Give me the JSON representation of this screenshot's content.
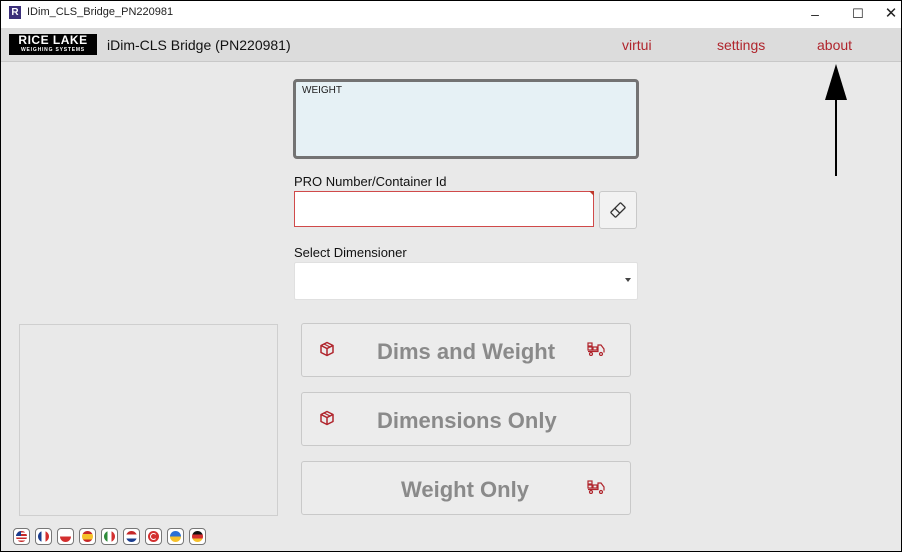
{
  "window": {
    "title": "IDim_CLS_Bridge_PN220981",
    "minimize_glyph": "–",
    "maximize_glyph": "☐",
    "close_glyph": "✕"
  },
  "app_bar": {
    "logo_text": "RICE LAKE",
    "logo_subtext": "WEIGHING SYSTEMS",
    "title": "iDim-CLS Bridge (PN220981)",
    "nav": {
      "virtui": "virtui",
      "settings": "settings",
      "about": "about"
    },
    "accent_color": "#b0242c"
  },
  "weight_box": {
    "label": "WEIGHT",
    "value": ""
  },
  "pro_number": {
    "label": "PRO Number/Container Id",
    "value": "",
    "clear_icon": "eraser-icon"
  },
  "dimensioner": {
    "label": "Select Dimensioner",
    "selected": ""
  },
  "actions": {
    "dims_and_weight": {
      "label": "Dims and Weight",
      "icons": [
        "box-icon",
        "truck-icon"
      ]
    },
    "dimensions_only": {
      "label": "Dimensions Only",
      "icons": [
        "box-icon"
      ]
    },
    "weight_only": {
      "label": "Weight Only",
      "icons": [
        "truck-icon"
      ]
    }
  },
  "languages": [
    "en-us",
    "fr",
    "pl",
    "es",
    "it",
    "nl",
    "tr",
    "uk",
    "de"
  ],
  "annotation": {
    "arrow_points_to": "about"
  }
}
